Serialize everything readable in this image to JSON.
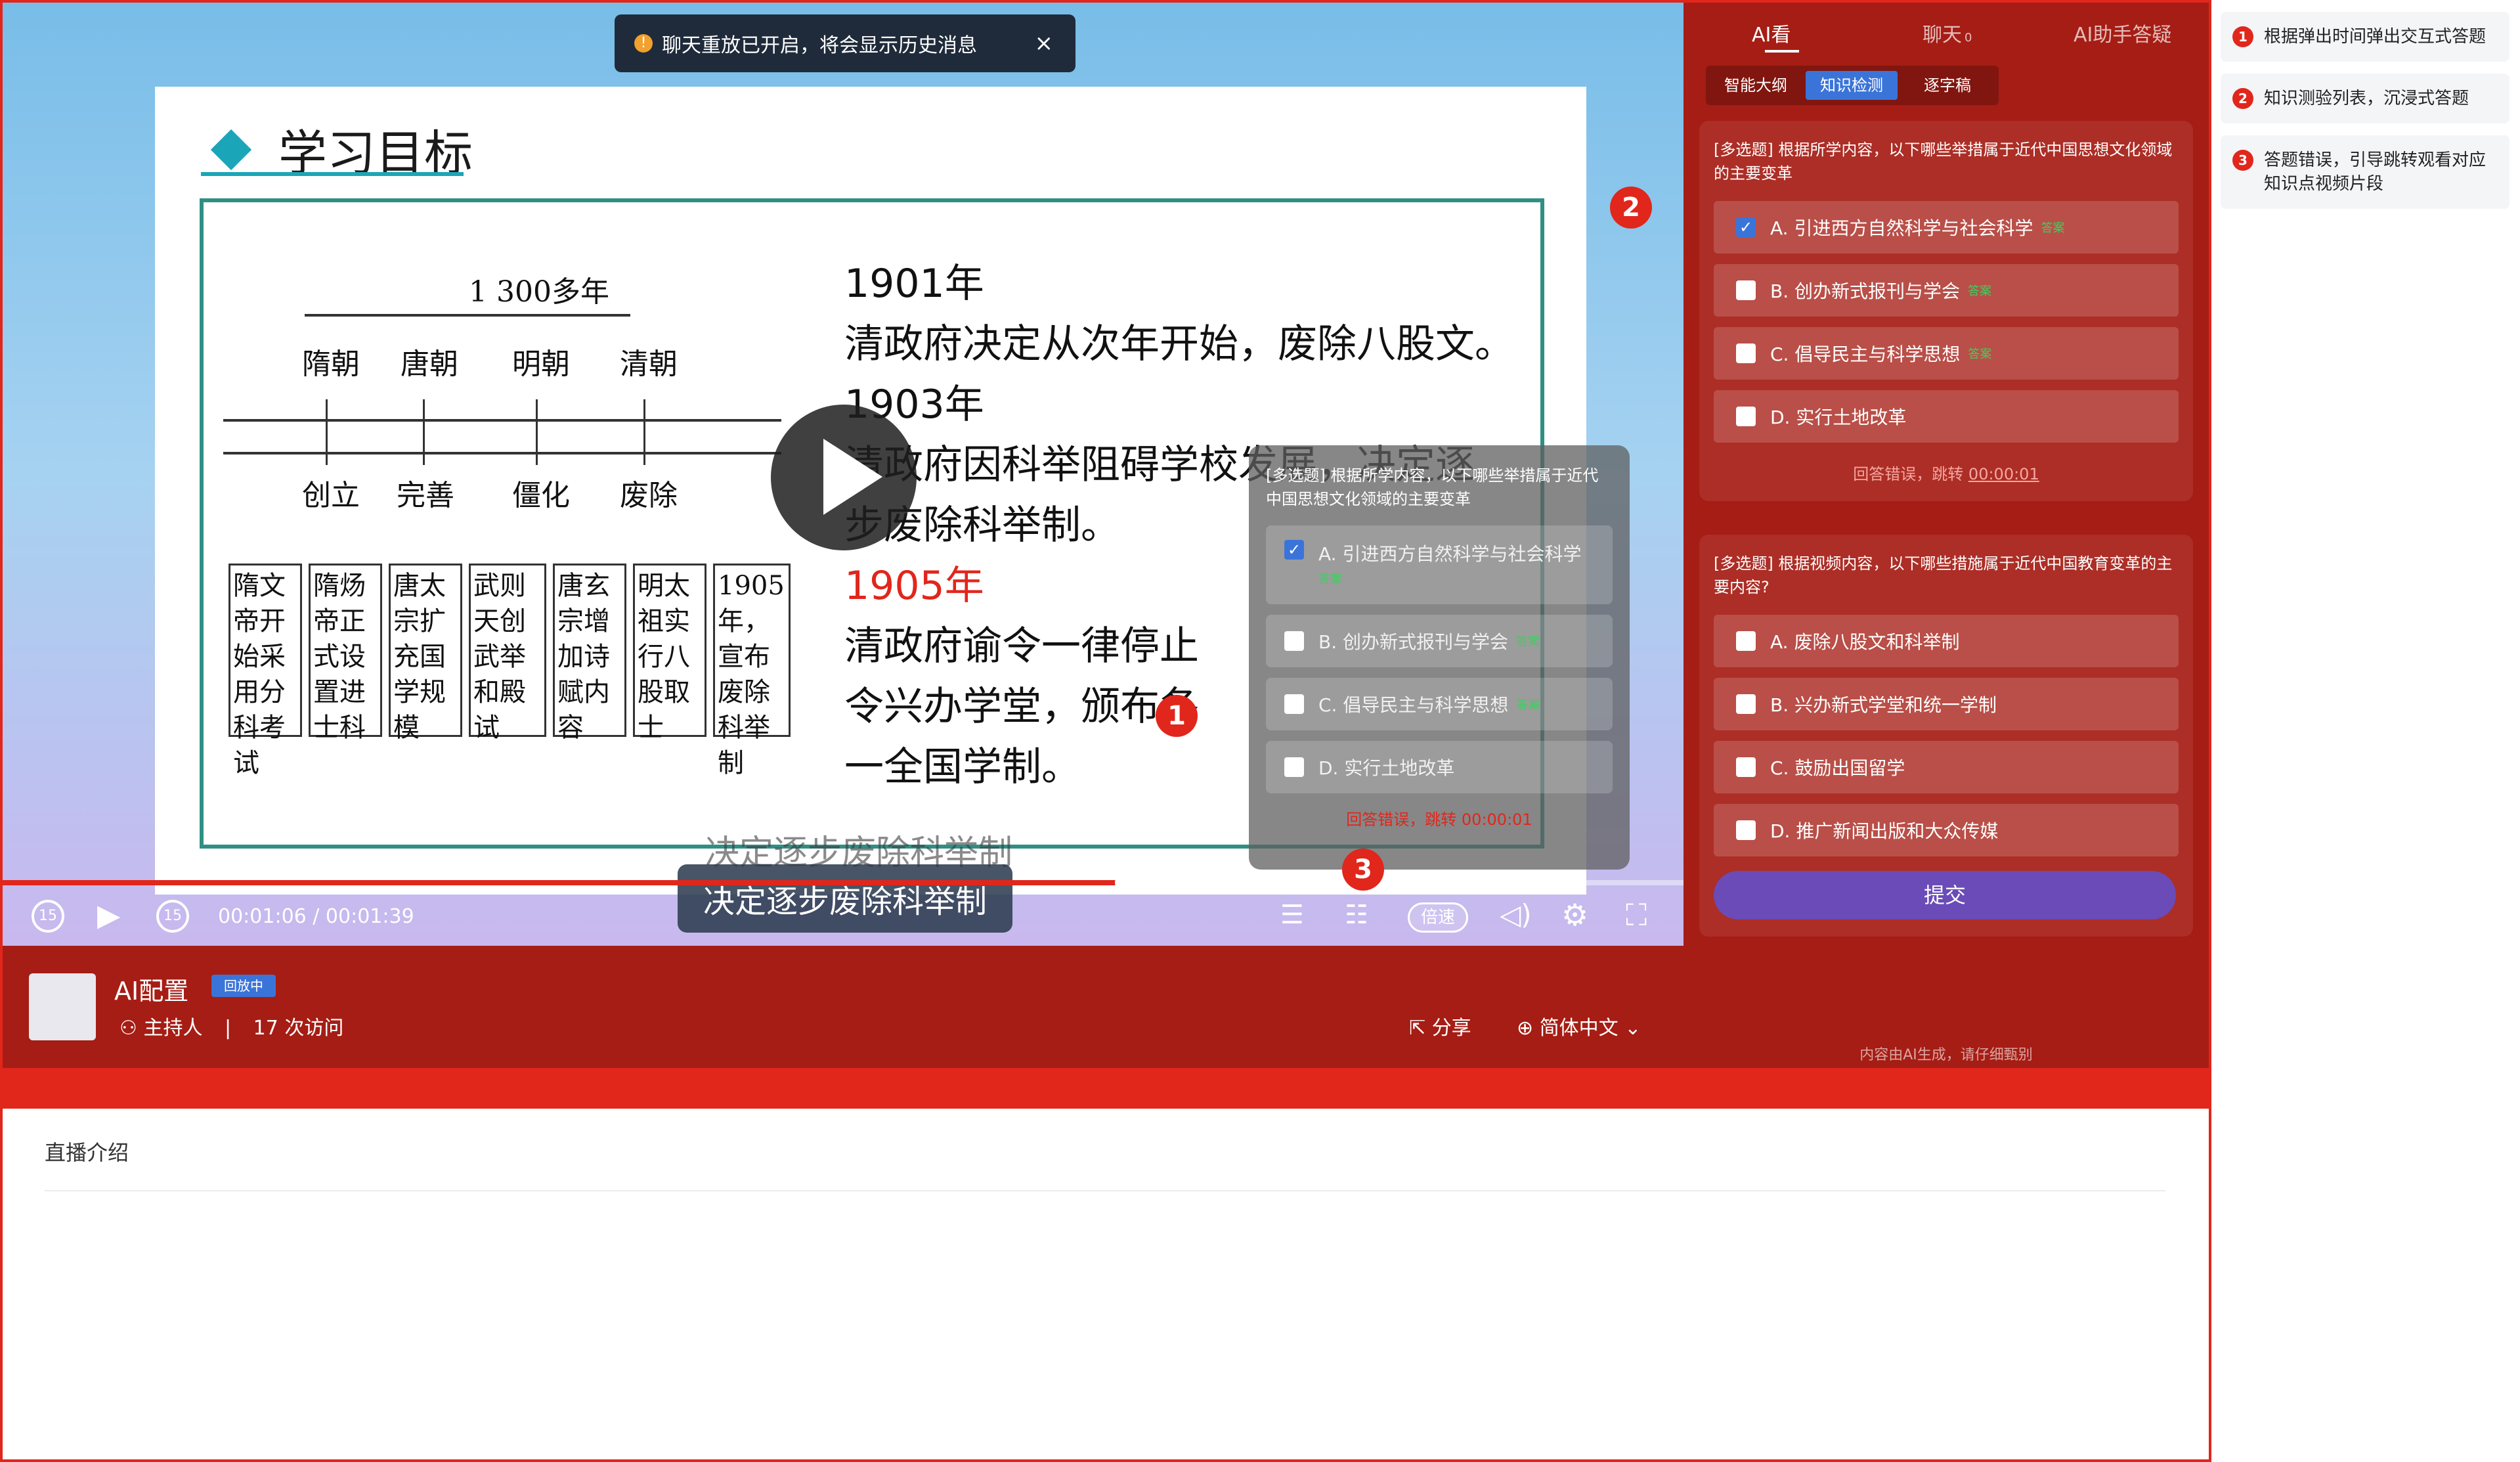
{
  "notice": {
    "text": "聊天重放已开启，将会显示历史消息",
    "close": "×"
  },
  "slide": {
    "title": "学习目标",
    "diagram": {
      "span": "1 300多年",
      "dynasties": [
        "隋朝",
        "唐朝",
        "明朝",
        "清朝"
      ],
      "stages": [
        "创立",
        "完善",
        "僵化",
        "废除"
      ],
      "cells": [
        "隋文帝开始采用分科考试",
        "隋炀帝正式设置进士科",
        "唐太宗扩充国学规模",
        "武则天创武举和殿试",
        "唐玄宗增加诗赋内容",
        "明太祖实行八股取士",
        "1905年，宣布废除科举制"
      ]
    },
    "lines": [
      "1901年",
      "清政府决定从次年开始，废除八股文。",
      "1903年",
      "清政府因科举阻碍学校发展，决定逐",
      "步废除科举制。",
      "1905年",
      "清政府谕令一律停止",
      "令兴办学堂，颁布各",
      "一全国学制。"
    ]
  },
  "player": {
    "subtitle_ghost": "决定逐步废除科举制",
    "subtitle": "决定逐步废除科举制",
    "time": "00:01:06 / 00:01:39",
    "progress": 0.667,
    "speed": "倍速",
    "rewind": "15",
    "forward": "15"
  },
  "overlay_quiz": {
    "question": "[多选题] 根据所学内容，以下哪些举措属于近代中国思想文化领域的主要变革",
    "options": [
      {
        "label": "A. 引进西方自然科学与社会科学",
        "tag": "答案",
        "checked": true
      },
      {
        "label": "B. 创办新式报刊与学会",
        "tag": "答案",
        "checked": false
      },
      {
        "label": "C. 倡导民主与科学思想",
        "tag": "答案",
        "checked": false
      },
      {
        "label": "D. 实行土地改革",
        "tag": "",
        "checked": false
      }
    ],
    "error": "回答错误，跳转 00:00:01"
  },
  "badges": [
    "1",
    "2",
    "3"
  ],
  "info": {
    "host_name": "AI配置",
    "replay": "回放中",
    "role": "主持人",
    "separator": "|",
    "visits": "17 次访问",
    "share": "分享",
    "language": "简体中文"
  },
  "intro": {
    "title": "直播介绍"
  },
  "panel": {
    "tabs": [
      "AI看",
      "聊天",
      "AI助手答疑"
    ],
    "chat_count": "0",
    "subtabs": [
      "智能大纲",
      "知识检测",
      "逐字稿"
    ],
    "quiz1": {
      "question": "[多选题] 根据所学内容，以下哪些举措属于近代中国思想文化领域的主要变革",
      "options": [
        {
          "label": "A. 引进西方自然科学与社会科学",
          "tag": "答案",
          "checked": true
        },
        {
          "label": "B. 创办新式报刊与学会",
          "tag": "答案",
          "checked": false
        },
        {
          "label": "C. 倡导民主与科学思想",
          "tag": "答案",
          "checked": false
        },
        {
          "label": "D. 实行土地改革",
          "tag": "",
          "checked": false
        }
      ],
      "error_text": "回答错误，跳转",
      "error_time": "00:00:01"
    },
    "quiz2": {
      "question": "[多选题] 根据视频内容，以下哪些措施属于近代中国教育变革的主要内容?",
      "options": [
        {
          "label": "A. 废除八股文和科举制"
        },
        {
          "label": "B. 兴办新式学堂和统一学制"
        },
        {
          "label": "C. 鼓励出国留学"
        },
        {
          "label": "D. 推广新闻出版和大众传媒"
        }
      ],
      "submit": "提交"
    },
    "ai_note": "内容由AI生成，请仔细甄别"
  },
  "notes": [
    {
      "n": "1",
      "text": "根据弹出时间弹出交互式答题"
    },
    {
      "n": "2",
      "text": "知识测验列表，沉浸式答题"
    },
    {
      "n": "3",
      "text": "答题错误，引导跳转观看对应知识点视频片段"
    }
  ],
  "colors": {
    "brand_red": "#e1261c",
    "panel_red": "#a51d14",
    "accent_blue": "#3b74d9",
    "submit_purple": "#6a4bb8"
  }
}
